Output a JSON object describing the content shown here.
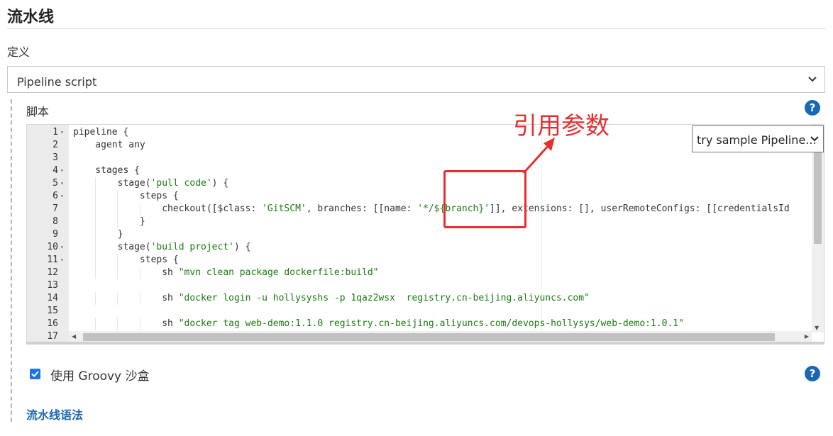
{
  "section": {
    "title": "流水线",
    "definition_label": "定义"
  },
  "definition_select": {
    "value": "Pipeline script"
  },
  "script": {
    "label": "脚本",
    "sample_select": "try sample Pipeline...",
    "lines": [
      {
        "num": "1",
        "fold": "▾",
        "text": "pipeline {"
      },
      {
        "num": "2",
        "fold": "",
        "text": "    agent any"
      },
      {
        "num": "3",
        "fold": "",
        "text": ""
      },
      {
        "num": "4",
        "fold": "▾",
        "text": "    stages {"
      },
      {
        "num": "5",
        "fold": "▾",
        "text": "        stage('pull code') {"
      },
      {
        "num": "6",
        "fold": "▾",
        "text": "            steps {"
      },
      {
        "num": "7",
        "fold": "",
        "text": "                checkout([$class: 'GitSCM', branches: [[name: '*/${branch}']], extensions: [], userRemoteConfigs: [[credentialsId"
      },
      {
        "num": "8",
        "fold": "",
        "text": "            }"
      },
      {
        "num": "9",
        "fold": "",
        "text": "        }"
      },
      {
        "num": "10",
        "fold": "▾",
        "text": "        stage('build project') {"
      },
      {
        "num": "11",
        "fold": "▾",
        "text": "            steps {"
      },
      {
        "num": "12",
        "fold": "",
        "text": "                sh \"mvn clean package dockerfile:build\""
      },
      {
        "num": "13",
        "fold": "",
        "text": ""
      },
      {
        "num": "14",
        "fold": "",
        "text": "                sh \"docker login -u hollysyshs -p 1qaz2wsx  registry.cn-beijing.aliyuncs.com\""
      },
      {
        "num": "15",
        "fold": "",
        "text": ""
      },
      {
        "num": "16",
        "fold": "",
        "text": "                sh \"docker tag web-demo:1.1.0 registry.cn-beijing.aliyuncs.com/devops-hollysys/web-demo:1.0.1\""
      },
      {
        "num": "17",
        "fold": "",
        "text": ""
      }
    ]
  },
  "annotation": {
    "text": "引用参数"
  },
  "sandbox": {
    "label": "使用 Groovy 沙盒",
    "checked": true
  },
  "syntax_link": "流水线语法",
  "colors": {
    "accent": "#1a67b3",
    "annotation": "#e53030",
    "string": "#1a7a10"
  }
}
